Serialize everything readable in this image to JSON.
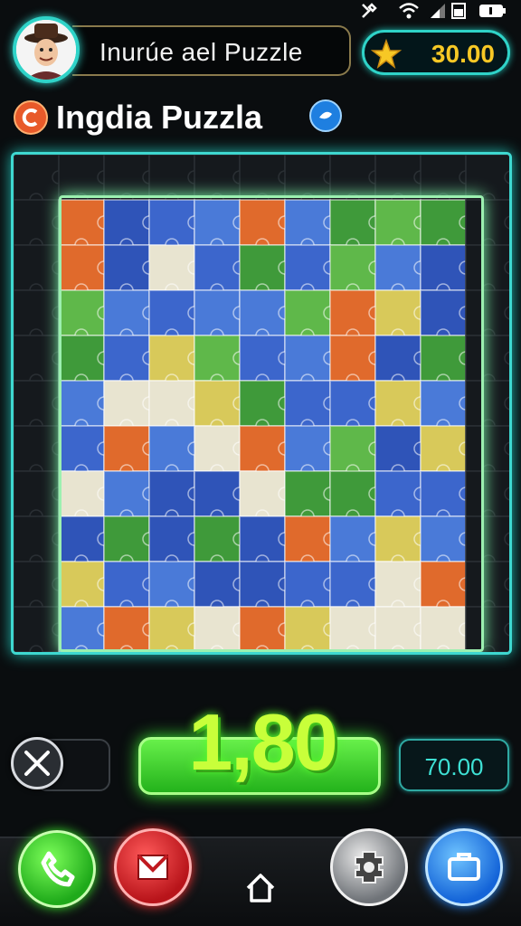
{
  "header": {
    "title": "Inurúe ael Puzzle",
    "coins": "30.00"
  },
  "game": {
    "title": "Ingdia Puzzla"
  },
  "controls": {
    "timer": "1,80",
    "score": "70.00"
  },
  "colors": {
    "accent": "#2fd3c8",
    "coin": "#f7c825",
    "timer": "#c8ff3a",
    "piece_palette": [
      "#2f54b8",
      "#3c66cc",
      "#4a7ad8",
      "#3f9a3a",
      "#5fb84a",
      "#e06a2c",
      "#d8c95a",
      "#e8e4d0"
    ]
  },
  "icons": {
    "avatar": "cowboy-avatar",
    "coin": "gold-star-icon",
    "logo": "orange-swirl-icon",
    "info": "blue-info-icon",
    "close": "close-icon",
    "phone": "phone-icon",
    "mail": "mail-icon",
    "home": "home-icon",
    "settings": "puzzle-gear-icon",
    "briefcase": "briefcase-icon"
  }
}
